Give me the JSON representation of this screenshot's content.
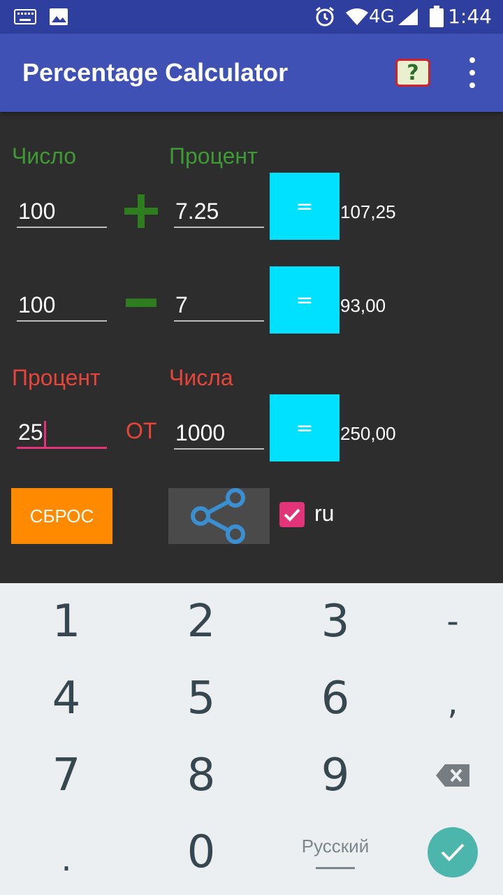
{
  "status_bar": {
    "network": "4G",
    "time": "1:44"
  },
  "app_bar": {
    "title": "Percentage Calculator",
    "help_label": "?"
  },
  "row_add": {
    "number_label": "Число",
    "percent_label": "Процент",
    "number_value": "100",
    "operator": "+",
    "percent_value": "7.25",
    "equals_label": "=",
    "result": "107,25"
  },
  "row_subtract": {
    "number_value": "100",
    "operator": "−",
    "percent_value": "7",
    "equals_label": "=",
    "result": "93,00"
  },
  "row_of": {
    "percent_label": "Процент",
    "number_label": "Числа",
    "percent_value": "25",
    "connector": "ОТ",
    "number_value": "1000",
    "equals_label": "=",
    "result": "250,00"
  },
  "controls": {
    "reset_label": "СБРОС",
    "language_checkbox_label": "ru",
    "language_checked": true
  },
  "keyboard": {
    "row1": [
      "1",
      "2",
      "3",
      "-"
    ],
    "row2": [
      "4",
      "5",
      "6",
      ","
    ],
    "row3": [
      "7",
      "8",
      "9"
    ],
    "row4_left": ".",
    "row4_zero": "0",
    "language": "Русский"
  },
  "colors": {
    "app_bar": "#3f51b5",
    "accent_green": "#3e9a33",
    "accent_red": "#e8443a",
    "equals_button": "#00e0ff",
    "reset_button": "#ff8a00",
    "checkbox": "#e3347a"
  }
}
